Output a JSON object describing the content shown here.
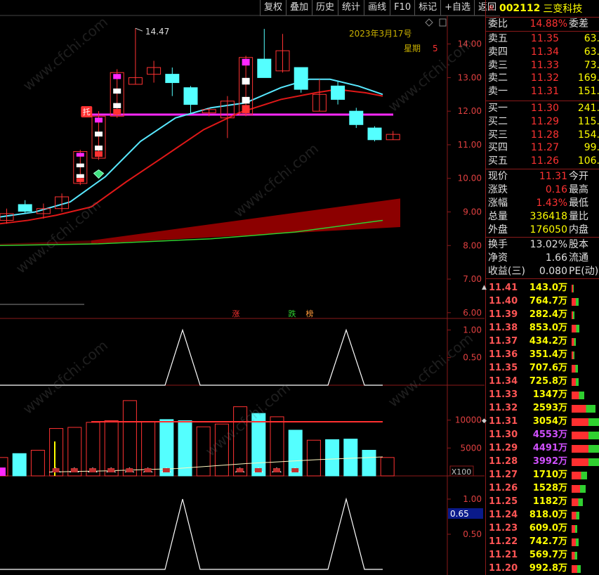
{
  "toolbar": [
    "复权",
    "叠加",
    "历史",
    "统计",
    "画线",
    "F10",
    "标记",
    "+自选",
    "返回"
  ],
  "chart": {
    "date": "2023年3月17号",
    "weekday_label": "星期",
    "weekday_value": "5",
    "high_label": "14.47",
    "watermark": "www.cfchi.com",
    "tuo_mark": "托",
    "zhang_label": "涨",
    "die_label": "跌",
    "bang_label": "榜",
    "x100": "X100",
    "ind_value": "0.65",
    "price_axis": [
      "14.00",
      "13.00",
      "12.00",
      "11.00",
      "10.00",
      "9.00",
      "8.00",
      "7.00",
      "6.00"
    ],
    "ind1_axis": [
      "1.00",
      "0.50"
    ],
    "vol_axis": [
      "10000",
      "5000"
    ],
    "ind2_axis": [
      "1.00",
      "0.50"
    ]
  },
  "stock": {
    "r_mark": "R",
    "code": "002112",
    "name": "三变科技"
  },
  "weibi": {
    "label": "委比",
    "value": "14.88%",
    "label2": "委差"
  },
  "asks": [
    {
      "label": "卖五",
      "price": "11.35",
      "vol": "63."
    },
    {
      "label": "卖四",
      "price": "11.34",
      "vol": "63."
    },
    {
      "label": "卖三",
      "price": "11.33",
      "vol": "73."
    },
    {
      "label": "卖二",
      "price": "11.32",
      "vol": "169."
    },
    {
      "label": "卖一",
      "price": "11.31",
      "vol": "151."
    }
  ],
  "bids": [
    {
      "label": "买一",
      "price": "11.30",
      "vol": "241."
    },
    {
      "label": "买二",
      "price": "11.29",
      "vol": "115."
    },
    {
      "label": "买三",
      "price": "11.28",
      "vol": "154."
    },
    {
      "label": "买四",
      "price": "11.27",
      "vol": "99."
    },
    {
      "label": "买五",
      "price": "11.26",
      "vol": "106."
    }
  ],
  "quote": [
    {
      "label": "现价",
      "value": "11.31",
      "label2": "今开"
    },
    {
      "label": "涨跌",
      "value": "0.16",
      "label2": "最高"
    },
    {
      "label": "涨幅",
      "value": "1.43%",
      "label2": "最低"
    },
    {
      "label": "总量",
      "value": "336418",
      "label2": "量比"
    },
    {
      "label": "外盘",
      "value": "176050",
      "label2": "内盘"
    }
  ],
  "fin": [
    {
      "label": "换手",
      "value": "13.02%",
      "label2": "股本"
    },
    {
      "label": "净资",
      "value": "1.66",
      "label2": "流通"
    },
    {
      "label": "收益(三)",
      "value": "0.080",
      "label2": "PE(动)"
    }
  ],
  "ticks": [
    {
      "price": "11.41",
      "vol": "143.0万",
      "color": "#ffff00",
      "bar": 0.04,
      "mark": "▲"
    },
    {
      "price": "11.40",
      "vol": "764.7万",
      "color": "#ffff00",
      "bar": 0.25
    },
    {
      "price": "11.39",
      "vol": "282.4万",
      "color": "#ffff00",
      "bar": 0.09
    },
    {
      "price": "11.38",
      "vol": "853.0万",
      "color": "#ffff00",
      "bar": 0.28
    },
    {
      "price": "11.37",
      "vol": "434.2万",
      "color": "#ffff00",
      "bar": 0.14
    },
    {
      "price": "11.36",
      "vol": "351.4万",
      "color": "#ffff00",
      "bar": 0.11
    },
    {
      "price": "11.35",
      "vol": "707.6万",
      "color": "#ffff00",
      "bar": 0.23
    },
    {
      "price": "11.34",
      "vol": "725.8万",
      "color": "#ffff00",
      "bar": 0.24
    },
    {
      "price": "11.33",
      "vol": "1347万",
      "color": "#ffff00",
      "bar": 0.44
    },
    {
      "price": "11.32",
      "vol": "2593万",
      "color": "#ffff00",
      "bar": 0.85
    },
    {
      "price": "11.31",
      "vol": "3054万",
      "color": "#ffff00",
      "bar": 1.0,
      "mark": "◆"
    },
    {
      "price": "11.30",
      "vol": "4553万",
      "color": "#d050ff",
      "bar": 1.0
    },
    {
      "price": "11.29",
      "vol": "4491万",
      "color": "#d050ff",
      "bar": 1.0
    },
    {
      "price": "11.28",
      "vol": "3992万",
      "color": "#d050ff",
      "bar": 1.0
    },
    {
      "price": "11.27",
      "vol": "1710万",
      "color": "#ffff00",
      "bar": 0.56
    },
    {
      "price": "11.26",
      "vol": "1528万",
      "color": "#ffff00",
      "bar": 0.5
    },
    {
      "price": "11.25",
      "vol": "1182万",
      "color": "#ffff00",
      "bar": 0.39
    },
    {
      "price": "11.24",
      "vol": "818.0万",
      "color": "#ffff00",
      "bar": 0.27
    },
    {
      "price": "11.23",
      "vol": "609.0万",
      "color": "#ffff00",
      "bar": 0.2
    },
    {
      "price": "11.22",
      "vol": "742.7万",
      "color": "#ffff00",
      "bar": 0.24
    },
    {
      "price": "11.21",
      "vol": "569.7万",
      "color": "#ffff00",
      "bar": 0.19
    },
    {
      "price": "11.20",
      "vol": "992.8万",
      "color": "#ffff00",
      "bar": 0.33
    }
  ],
  "colors": {
    "up": "#ff3232",
    "down": "#54ffff",
    "ma_red": "#e01818",
    "ma_cyan": "#58e8ff",
    "ma_green": "#30d030",
    "magenta": "#ff28ff",
    "band": "#8c0000"
  },
  "chart_data": {
    "type": "candlestick",
    "candles": [
      {
        "o": 8.75,
        "c": 8.95,
        "h": 9.1,
        "l": 8.65
      },
      {
        "o": 9.22,
        "c": 9.02,
        "h": 9.35,
        "l": 8.95
      },
      {
        "o": 8.95,
        "c": 9.1,
        "h": 9.25,
        "l": 8.8
      },
      {
        "o": 9.1,
        "c": 9.45,
        "h": 9.55,
        "l": 9.0
      },
      {
        "o": 9.85,
        "c": 10.8,
        "h": 10.85,
        "l": 9.8
      },
      {
        "o": 10.6,
        "c": 11.85,
        "h": 12.0,
        "l": 10.55
      },
      {
        "o": 11.85,
        "c": 13.15,
        "h": 13.25,
        "l": 11.8
      },
      {
        "o": 12.8,
        "c": 13.0,
        "h": 14.47,
        "l": 12.8
      },
      {
        "o": 13.1,
        "c": 13.3,
        "h": 13.5,
        "l": 12.85
      },
      {
        "o": 13.1,
        "c": 12.85,
        "h": 13.3,
        "l": 12.45
      },
      {
        "o": 12.7,
        "c": 12.2,
        "h": 12.75,
        "l": 11.95
      },
      {
        "o": 11.95,
        "c": 12.05,
        "h": 12.1,
        "l": 11.85
      },
      {
        "o": 11.8,
        "c": 12.3,
        "h": 12.45,
        "l": 11.2
      },
      {
        "o": 11.9,
        "c": 13.6,
        "h": 13.65,
        "l": 11.85
      },
      {
        "o": 13.55,
        "c": 13.0,
        "h": 14.45,
        "l": 13.5
      },
      {
        "o": 13.2,
        "c": 13.8,
        "h": 14.3,
        "l": 13.15
      },
      {
        "o": 13.3,
        "c": 12.65,
        "h": 13.3,
        "l": 12.55
      },
      {
        "o": 12.0,
        "c": 12.5,
        "h": 12.95,
        "l": 12.0
      },
      {
        "o": 12.75,
        "c": 12.35,
        "h": 12.9,
        "l": 12.2
      },
      {
        "o": 12.0,
        "c": 11.6,
        "h": 12.1,
        "l": 11.5
      },
      {
        "o": 11.5,
        "c": 11.15,
        "h": 11.55,
        "l": 11.1
      },
      {
        "o": 11.15,
        "c": 11.31,
        "h": 11.41,
        "l": 11.15
      }
    ],
    "volume": [
      3300,
      4000,
      4600,
      8500,
      8700,
      9600,
      9900,
      13500,
      9700,
      10100,
      9900,
      8800,
      9300,
      12400,
      11200,
      10600,
      8200,
      6400,
      6500,
      6600,
      4600,
      3300
    ],
    "ylim": [
      5.85,
      14.85
    ]
  }
}
